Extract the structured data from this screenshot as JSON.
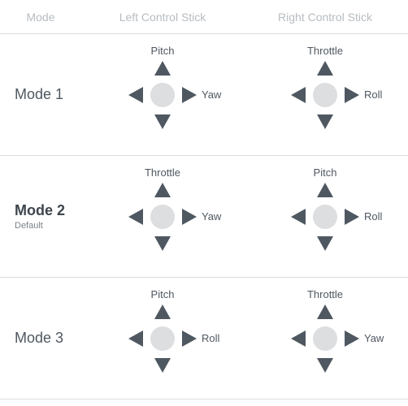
{
  "headers": {
    "mode": "Mode",
    "left": "Left Control Stick",
    "right": "Right Control Stick"
  },
  "rows": [
    {
      "mode_label": "Mode 1",
      "is_default": false,
      "left": {
        "top": "Pitch",
        "right": "Yaw"
      },
      "right": {
        "top": "Throttle",
        "right": "Roll"
      }
    },
    {
      "mode_label": "Mode 2",
      "is_default": true,
      "default_text": "Default",
      "left": {
        "top": "Throttle",
        "right": "Yaw"
      },
      "right": {
        "top": "Pitch",
        "right": "Roll"
      }
    },
    {
      "mode_label": "Mode 3",
      "is_default": false,
      "left": {
        "top": "Pitch",
        "right": "Roll"
      },
      "right": {
        "top": "Throttle",
        "right": "Yaw"
      }
    }
  ],
  "colors": {
    "arrow": "#4f5861",
    "hub": "#dcdedf",
    "divider": "#d9dbdd",
    "header_text": "#b7bcc1"
  }
}
